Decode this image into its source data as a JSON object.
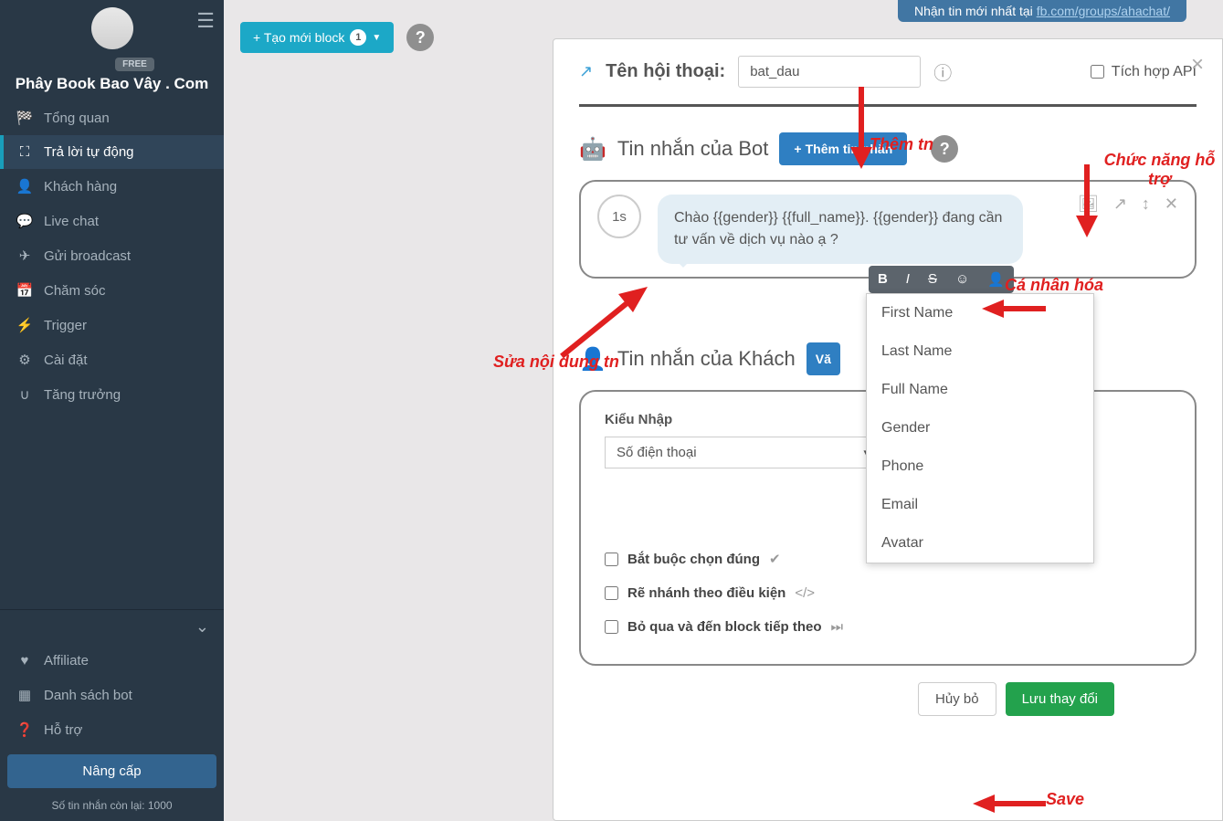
{
  "sidebar": {
    "free_badge": "FREE",
    "site_title": "Phây Book Bao Vây . Com",
    "items": [
      {
        "icon": "◐",
        "label": "Tổng quan"
      },
      {
        "icon": "⚗",
        "label": "Trả lời tự động"
      },
      {
        "icon": "👤",
        "label": "Khách hàng"
      },
      {
        "icon": "💬",
        "label": "Live chat"
      },
      {
        "icon": "✈",
        "label": "Gửi broadcast"
      },
      {
        "icon": "📅",
        "label": "Chăm sóc"
      },
      {
        "icon": "⚡",
        "label": "Trigger"
      },
      {
        "icon": "⚙",
        "label": "Cài đặt"
      },
      {
        "icon": "🧲",
        "label": "Tăng trưởng"
      }
    ],
    "lower": [
      {
        "icon": "♥",
        "label": "Affiliate"
      },
      {
        "icon": "▦",
        "label": "Danh sách bot"
      },
      {
        "icon": "❓",
        "label": "Hỗ trợ"
      }
    ],
    "upgrade": "Nâng cấp",
    "msg_count": "Số tin nhắn còn lại: 1000"
  },
  "top_banner": {
    "prefix": "Nhận tin mới nhất tại ",
    "link": "fb.com/groups/ahachat/"
  },
  "toolbar": {
    "create_block": "+ Tạo mới block",
    "count": "1"
  },
  "modal": {
    "dialog_label": "Tên hội thoại:",
    "dialog_name": "bat_dau",
    "api_label": "Tích hợp API",
    "bot_section": "Tin nhắn của Bot",
    "add_msg": "Thêm tin nhắn",
    "time": "1s",
    "bubble": "Chào {{gender}} {{full_name}}. {{gender}} đang cần tư vấn về dịch vụ nào ạ ?",
    "customer_section": "Tin nhắn của Khách",
    "van": "Vă",
    "input_type_label": "Kiểu Nhập",
    "input_type_value": "Số điện thoại",
    "check1": "Bắt buộc chọn đúng",
    "check2": "Rẽ nhánh theo điều kiện",
    "check3": "Bỏ qua và đến block tiếp theo",
    "cancel": "Hủy bỏ",
    "save": "Lưu thay đổi"
  },
  "dropdown": [
    "First Name",
    "Last Name",
    "Full Name",
    "Gender",
    "Phone",
    "Email",
    "Avatar"
  ],
  "annotations": {
    "add_msg": "Thêm tn",
    "tools": "Chức năng hỗ trợ",
    "personalize": "Cá nhân hóa",
    "edit": "Sửa nội dung tn",
    "save": "Save"
  }
}
